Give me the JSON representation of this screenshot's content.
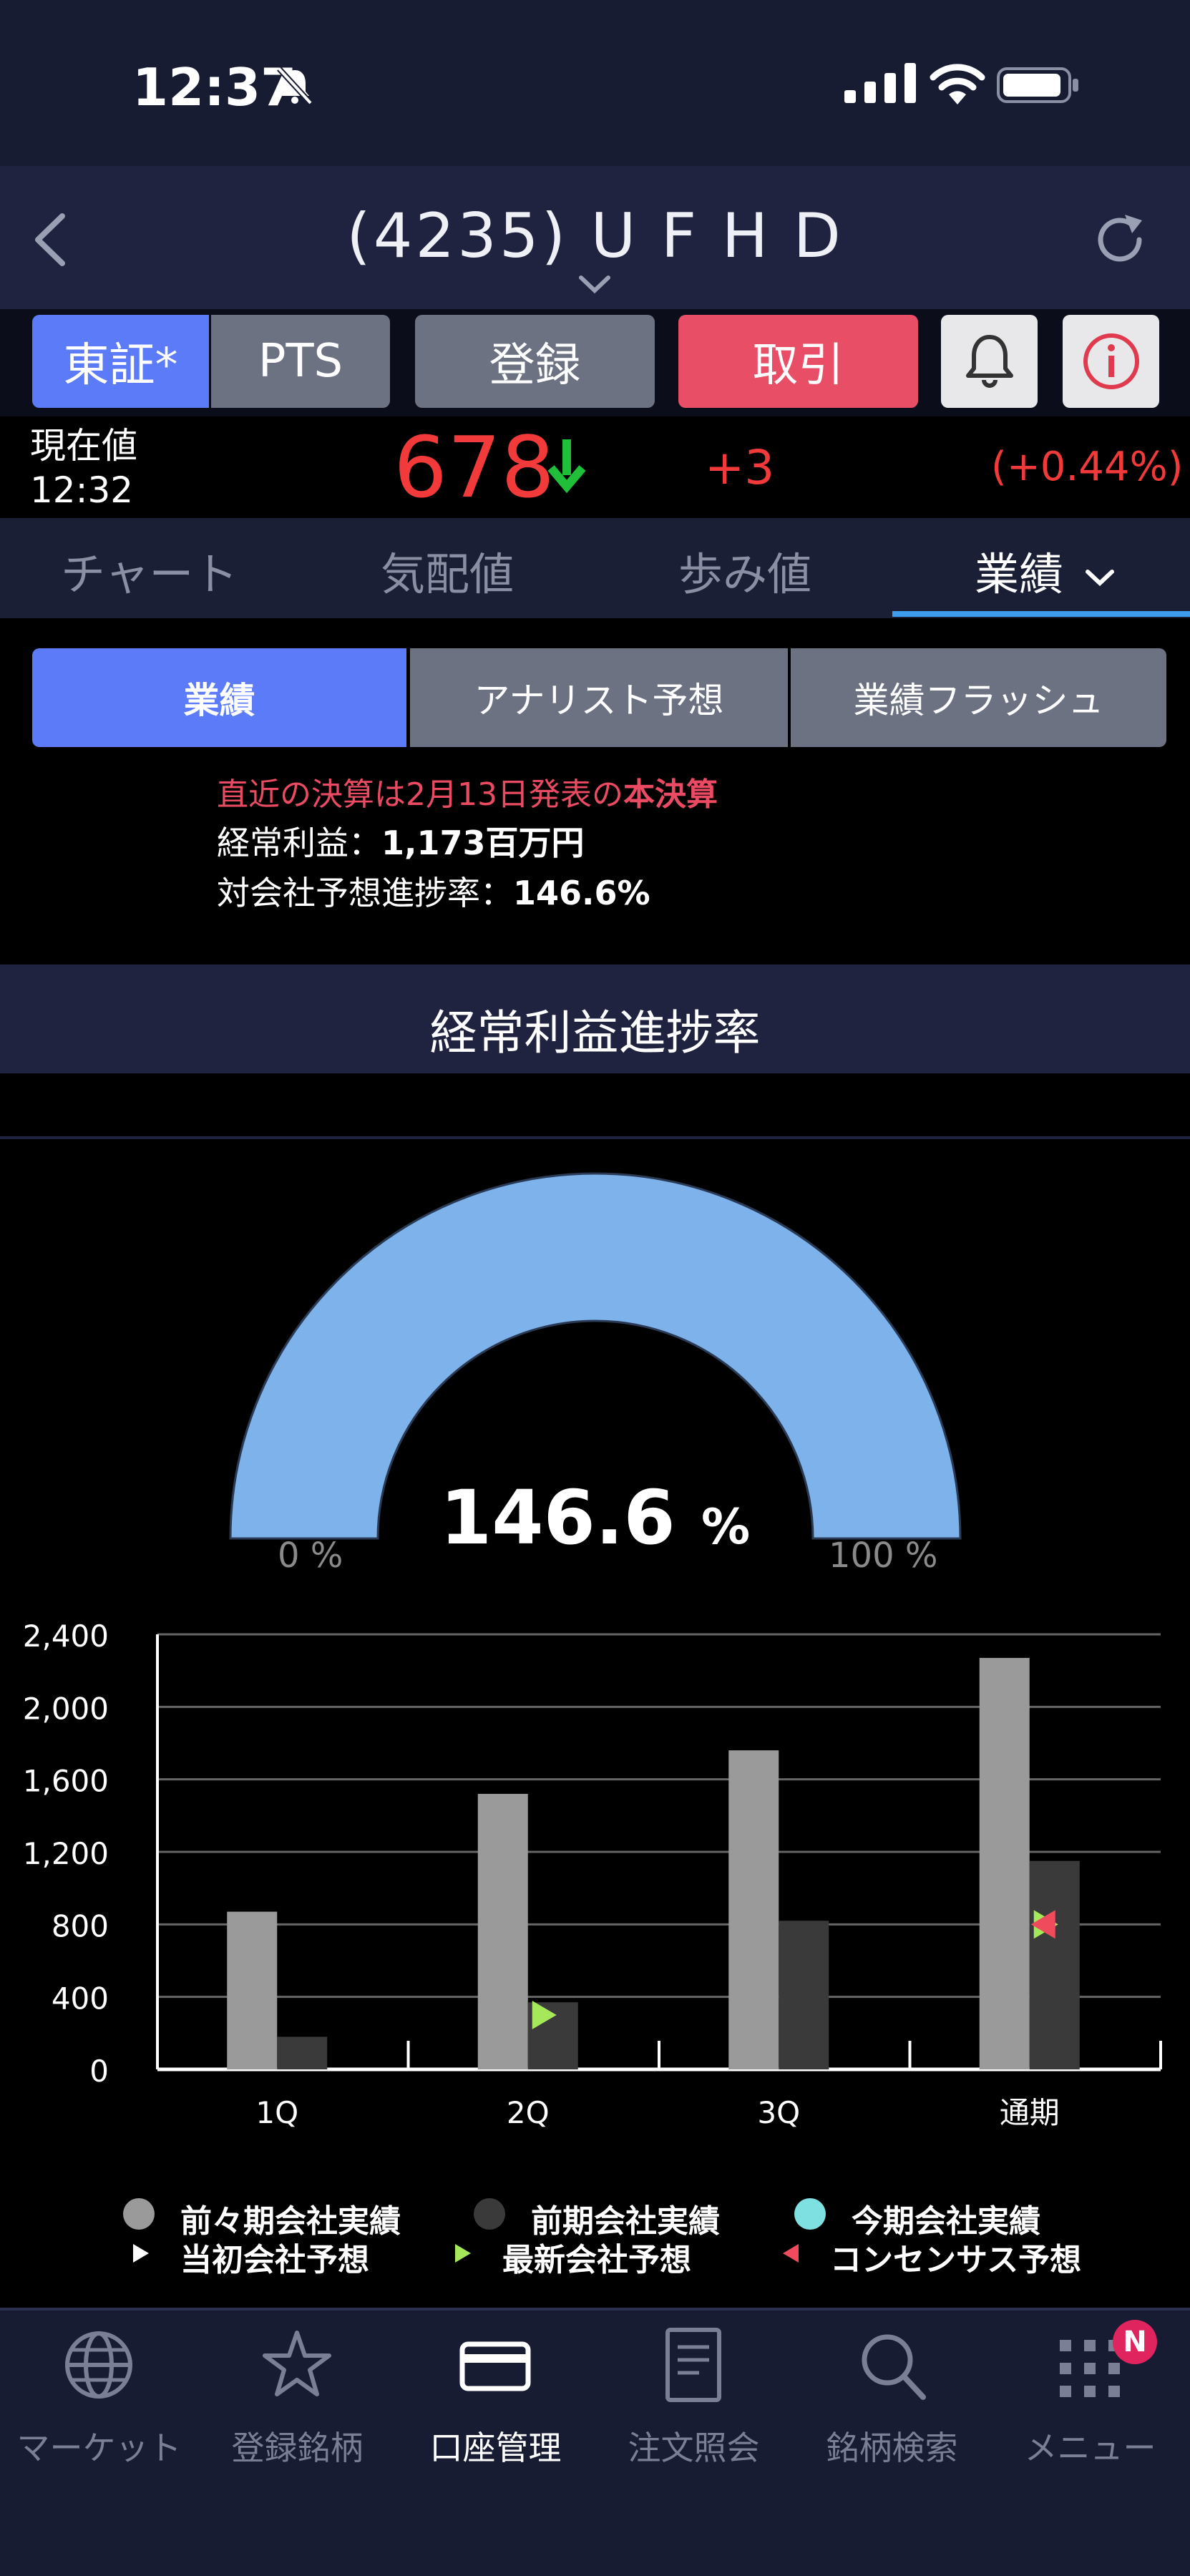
{
  "status_bar": {
    "time": "12:37"
  },
  "header": {
    "title": "(4235) U F H D"
  },
  "market_buttons": {
    "tosho": "東証*",
    "pts": "PTS",
    "register": "登録",
    "trade": "取引"
  },
  "price": {
    "label": "現在値",
    "time": "12:32",
    "value": "678",
    "change": "+3",
    "change_pct": "(+0.44%)",
    "up_color": "#f23a3a",
    "arrow_color": "#1fbf3a"
  },
  "tabs": [
    {
      "label": "チャート"
    },
    {
      "label": "気配値"
    },
    {
      "label": "歩み値"
    },
    {
      "label": "業績"
    }
  ],
  "segments": [
    {
      "label": "業績"
    },
    {
      "label": "アナリスト予想"
    },
    {
      "label": "業績フラッシュ"
    }
  ],
  "summary": {
    "announce_prefix": "直近の決算は2月13日発表の",
    "announce_type": "本決算",
    "ordinary_label": "経常利益：",
    "ordinary_value": "1,173百万円",
    "progress_label": "対会社予想進捗率：",
    "progress_value": "146.6%"
  },
  "section_title": "経常利益進捗率",
  "gauge": {
    "percent": "146.6",
    "unit": "%",
    "min_label": "0 %",
    "max_label": "100 %",
    "value": 146.6,
    "fill_color": "#7db2ea"
  },
  "chart_data": {
    "type": "bar",
    "categories": [
      "1Q",
      "2Q",
      "3Q",
      "通期"
    ],
    "y_ticks": [
      "2,400",
      "2,000",
      "1,600",
      "1,200",
      "800",
      "400",
      "0"
    ],
    "ylim": [
      0,
      2400
    ],
    "series": [
      {
        "name": "前々期会社実績",
        "color": "#9a9a9a",
        "values": [
          870,
          1520,
          1760,
          2270
        ]
      },
      {
        "name": "前期会社実績",
        "color": "#3a3a3a",
        "values": [
          180,
          370,
          820,
          1150
        ]
      }
    ],
    "markers": [
      {
        "name": "最新会社予想",
        "category": "2Q",
        "value": 300,
        "color": "#a5e85a"
      },
      {
        "name": "最新会社予想",
        "category": "通期",
        "value": 800,
        "color": "#a5e85a"
      },
      {
        "name": "コンセンサス予想",
        "category": "通期",
        "value": 800,
        "color": "#ef4b5c"
      }
    ],
    "grid": true
  },
  "legend": [
    {
      "label": "前々期会社実績",
      "color": "#9a9a9a",
      "shape": "dot"
    },
    {
      "label": "前期会社実績",
      "color": "#3a3a3a",
      "shape": "dot"
    },
    {
      "label": "今期会社実績",
      "color": "#7ee0e0",
      "shape": "dot"
    },
    {
      "label": "当初会社予想",
      "color": "#ffffff",
      "shape": "triangle-right"
    },
    {
      "label": "最新会社予想",
      "color": "#a5e85a",
      "shape": "triangle-right"
    },
    {
      "label": "コンセンサス予想",
      "color": "#ef4b5c",
      "shape": "triangle-left"
    }
  ],
  "bottom_nav": [
    {
      "label": "マーケット",
      "icon": "globe-icon"
    },
    {
      "label": "登録銘柄",
      "icon": "star-icon"
    },
    {
      "label": "口座管理",
      "icon": "card-icon"
    },
    {
      "label": "注文照会",
      "icon": "document-icon"
    },
    {
      "label": "銘柄検索",
      "icon": "search-icon"
    },
    {
      "label": "メニュー",
      "icon": "grid-icon"
    }
  ],
  "menu_badge": "N"
}
